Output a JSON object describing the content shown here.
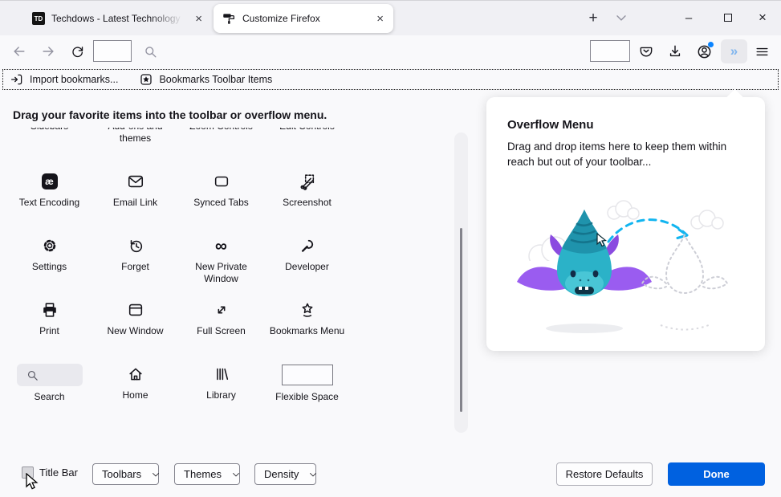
{
  "tab_bar": {
    "new_tab_glyph": "+",
    "tabs": [
      {
        "favicon_text": "TD",
        "title": "Techdows - Latest Technology N",
        "close_glyph": "×"
      },
      {
        "title": "Customize Firefox",
        "close_glyph": "×"
      }
    ],
    "window_controls": {
      "minimize_glyph": "–",
      "close_glyph": "×"
    }
  },
  "nav_toolbar": {
    "overflow_glyph": "»",
    "icons": [
      "back-arrow-icon",
      "forward-arrow-icon",
      "reload-icon",
      "search-icon",
      "pocket-icon",
      "download-icon",
      "account-icon",
      "overflow-chevron-icon",
      "menu-icon"
    ]
  },
  "bookmarks_bar": {
    "import_label": "Import bookmarks...",
    "toolbar_items_label": "Bookmarks Toolbar Items"
  },
  "customize": {
    "heading": "Drag your favorite items into the toolbar or overflow menu.",
    "palette": {
      "clipped_row": [
        {
          "label": "Sidebars"
        },
        {
          "line1": "Add-ons and",
          "line2": "themes"
        },
        {
          "label": "Zoom Controls"
        },
        {
          "label": "Edit Controls"
        }
      ],
      "rows": [
        [
          {
            "label": "Text Encoding",
            "icon": "text-encoding-icon"
          },
          {
            "label": "Email Link",
            "icon": "email-link-icon"
          },
          {
            "label": "Synced Tabs",
            "icon": "synced-tabs-icon"
          },
          {
            "label": "Screenshot",
            "icon": "screenshot-icon"
          }
        ],
        [
          {
            "label": "Settings",
            "icon": "settings-gear-icon"
          },
          {
            "label": "Forget",
            "icon": "forget-history-icon"
          },
          {
            "label": "New Private Window",
            "icon": "private-browsing-icon"
          },
          {
            "label": "Developer",
            "icon": "developer-wrench-icon"
          }
        ],
        [
          {
            "label": "Print",
            "icon": "printer-icon"
          },
          {
            "label": "New Window",
            "icon": "new-window-icon"
          },
          {
            "label": "Full Screen",
            "icon": "full-screen-icon"
          },
          {
            "label": "Bookmarks Menu",
            "icon": "bookmarks-star-icon"
          }
        ],
        [
          {
            "label": "Search",
            "icon": "search-magnifier-icon"
          },
          {
            "label": "Home",
            "icon": "home-icon"
          },
          {
            "label": "Library",
            "icon": "library-icon"
          },
          {
            "label": "Flexible Space",
            "icon": "flexible-space-box"
          }
        ]
      ]
    }
  },
  "overflow_panel": {
    "title": "Overflow Menu",
    "description": "Drag and drop items here to keep them within reach but out of your toolbar..."
  },
  "footer": {
    "title_bar_label": "Title Bar",
    "title_bar_checked": false,
    "dropdowns": [
      {
        "label": "Toolbars"
      },
      {
        "label": "Themes"
      },
      {
        "label": "Density"
      }
    ],
    "restore_defaults_label": "Restore Defaults",
    "done_label": "Done"
  },
  "icon_glyphs": {
    "text_encoding": "æ",
    "private_infinity": "∞"
  },
  "colors": {
    "done_button": "#0061e0",
    "overflow_chevron": "#7fb5ee",
    "account_badge": "#0a84ff",
    "illustration_teal": "#2bb2c8",
    "illustration_purple": "#9a5cf0",
    "dashed_arrow_cyan": "#12b5f0"
  }
}
